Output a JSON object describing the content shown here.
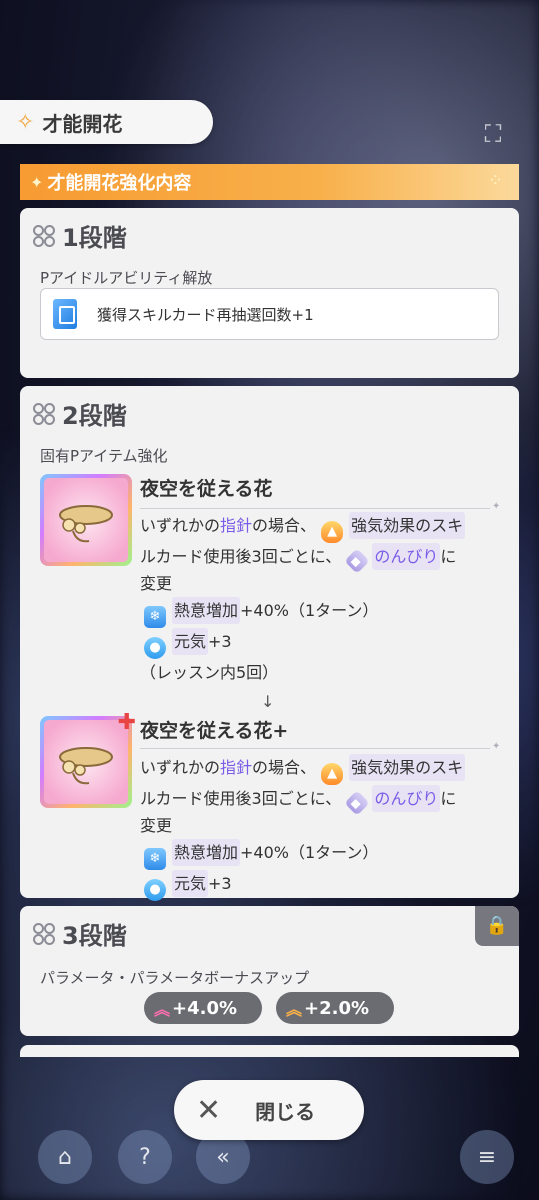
{
  "header": {
    "title": "才能開花"
  },
  "panel": {
    "title": "才能開花強化内容",
    "stage1": {
      "label": "1段階",
      "sub_label": "Pアイドルアビリティ解放",
      "skill_text": "獲得スキルカード再抽選回数+1"
    },
    "stage2": {
      "label": "2段階",
      "sub_label": "固有Pアイテム強化",
      "item_before": {
        "name": "夜空を従える花",
        "desc_1a": "いずれかの",
        "desc_1b": "指針",
        "desc_1c": "の場合、",
        "desc_1d": "強気効果のスキ",
        "desc_2a": "ルカード使用後3回ごとに、",
        "desc_2b": "のんびり",
        "desc_2c": "に",
        "desc_3": "変更",
        "effect_1a": "熱意増加",
        "effect_1b": "+40%（1ターン）",
        "effect_2a": "元気",
        "effect_2b": "+3",
        "limit": "（レッスン内5回）"
      },
      "arrow": "↓",
      "item_after": {
        "name": "夜空を従える花+",
        "desc_1a": "いずれかの",
        "desc_1b": "指針",
        "desc_1c": "の場合、",
        "desc_1d": "強気効果のスキ",
        "desc_2a": "ルカード使用後3回ごとに、",
        "desc_2b": "のんびり",
        "desc_2c": "に",
        "desc_3": "変更",
        "effect_1a": "熱意増加",
        "effect_1b": "+40%（1ターン）",
        "effect_2a": "元気",
        "effect_2b": "+3"
      }
    },
    "stage3": {
      "label": "3段階",
      "sub_label": "パラメータ・パラメータボーナスアップ",
      "bonus_1": "+4.0%",
      "bonus_2": "+2.0%"
    }
  },
  "close_button": {
    "label": "閉じる"
  },
  "colors": {
    "accent_orange": "#f79b32",
    "highlight_purple": "#7b5ce6",
    "panel_bg": "#f2f2f3",
    "pill_bg": "#6b6b72"
  }
}
